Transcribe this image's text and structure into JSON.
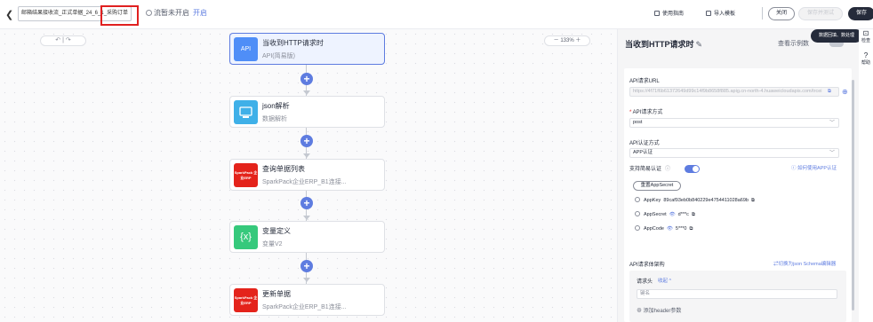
{
  "topbar": {
    "back_icon": "chevron-left-icon",
    "flow_name": "邮箱结果接收流_正式单据_24_6_1_采购订单",
    "flow_status": "流暂未开启",
    "flow_open_link": "开启",
    "usage_guide": "使用指南",
    "import_template": "导入模板",
    "close": "关闭",
    "save_and_test": "保存并测试",
    "save": "保存"
  },
  "canvas": {
    "undo_redo": "↶ | ↷",
    "zoom": "－  133%  ＋",
    "nodes": [
      {
        "title": "当收到HTTP请求时",
        "subtitle": "API(简易版)",
        "icon": "api-icon",
        "icon_text": "API"
      },
      {
        "title": "json解析",
        "subtitle": "数据解析",
        "icon": "json-parse-icon",
        "icon_text": ""
      },
      {
        "title": "查询单据列表",
        "subtitle": "SparkPack企业ERP_B1连接...",
        "icon": "sparkpack-logo",
        "icon_text": "SparkPack 企业ERP"
      },
      {
        "title": "变量定义",
        "subtitle": "变量V2",
        "icon": "variable-icon",
        "icon_text": "{x}"
      },
      {
        "title": "更新单据",
        "subtitle": "SparkPack企业ERP_B1连接...",
        "icon": "sparkpack-logo",
        "icon_text": "SparkPack 企业ERP"
      }
    ]
  },
  "panel": {
    "title": "当收到HTTP请求时",
    "view_example": "查看示例数",
    "tooltip": "数据回填、数处理",
    "api_url_label": "API请求URL",
    "api_url_value": "https://4f71f6b61372649d99c14f9b8658f885.apig.cn-north-4.huaweicloudapis.com/trcei",
    "method_label": "API请求方式",
    "method_value": "post",
    "auth_label": "API认证方式",
    "auth_value": "APP认证",
    "simple_auth_label": "支持简易认证",
    "how_to_use_link": "如何使用APP认证",
    "reset_button": "重置AppSecret",
    "appkey_label": "AppKey",
    "appkey_value": "89caf93eb0b840229e4754411028a69b",
    "appsecret_label": "AppSecret",
    "appsecret_value": "d***c",
    "appcode_label": "AppCode",
    "appcode_value": "5***0",
    "body_struct_label": "API请求体架构",
    "switch_schema_link": "⇄切换为json Schema编辑器",
    "header_tab": "请求头",
    "collapse": "收起 ^",
    "key_placeholder": "键名",
    "add_header": "⊕ 添加header参数"
  },
  "rightbar": {
    "check": "检查",
    "help": "帮助"
  }
}
